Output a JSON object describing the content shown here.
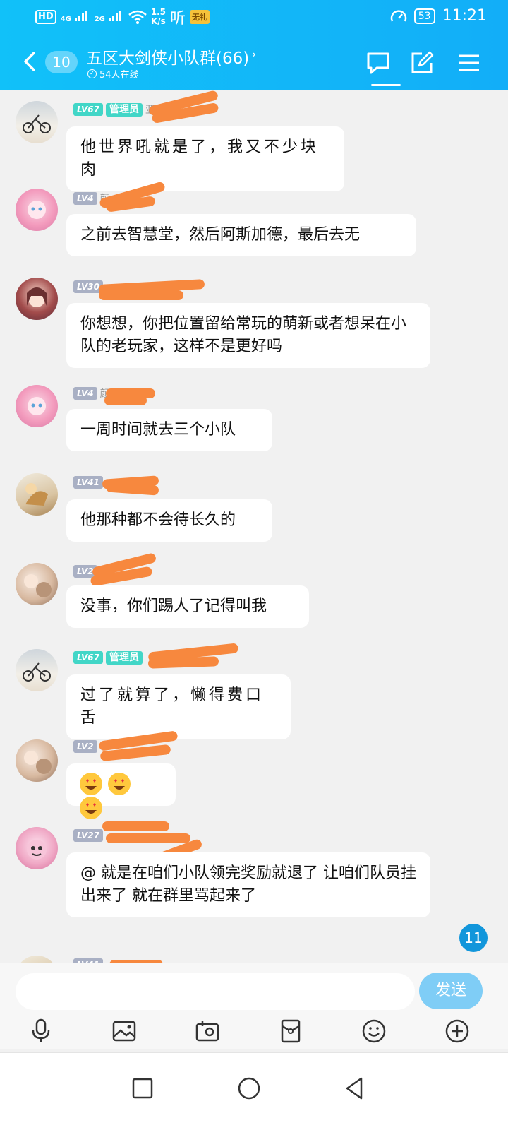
{
  "status_bar": {
    "hd_label": "HD",
    "net1": "4G",
    "net2": "2G",
    "speed_value": "1.5",
    "speed_unit": "K/s",
    "listen_label": "听",
    "badge_text": "无礼",
    "battery": "53",
    "time": "11:21"
  },
  "header": {
    "back_count": "10",
    "group_name": "五区大剑侠小队群(66)",
    "online_text": "54人在线"
  },
  "messages": [
    {
      "level": "LV67",
      "role": "管理员",
      "nick": "亚",
      "text": "他世界吼就是了，我又不少块肉",
      "hand": true
    },
    {
      "level": "LV4",
      "role": "",
      "nick": "颜",
      "text": "之前去智慧堂，然后阿斯加德，最后去无",
      "hand": false
    },
    {
      "level": "LV30",
      "role": "",
      "nick": "",
      "text": "你想想，你把位置留给常玩的萌新或者想呆在小队的老玩家，这样不是更好吗",
      "hand": false
    },
    {
      "level": "LV4",
      "role": "",
      "nick": "颜",
      "text": "一周时间就去三个小队",
      "hand": false
    },
    {
      "level": "LV41",
      "role": "",
      "nick": "",
      "text": "他那种都不会待长久的",
      "hand": false
    },
    {
      "level": "LV2",
      "role": "",
      "nick": "",
      "text": "没事，你们踢人了记得叫我",
      "hand": false
    },
    {
      "level": "LV67",
      "role": "管理员",
      "nick": "",
      "text": "过了就算了，懒得费口舌",
      "hand": true
    },
    {
      "level": "LV2",
      "role": "",
      "nick": "",
      "text": "",
      "hand": false
    },
    {
      "level": "LV27",
      "role": "",
      "nick": "",
      "text": "@                就是在咱们小队领完奖励就退了 让咱们队员挂出来了 就在群里骂起来了",
      "hand": false
    },
    {
      "level": "LV41",
      "role": "",
      "nick": "",
      "text": "",
      "hand": false
    }
  ],
  "unread_float": "11",
  "composer": {
    "placeholder": "",
    "send_label": "发送"
  },
  "icons": {
    "toolbar": [
      "mic-icon",
      "image-icon",
      "camera-icon",
      "red-packet-icon",
      "emoji-icon",
      "plus-icon"
    ],
    "sysnav": [
      "recents-icon",
      "home-icon",
      "back-icon"
    ]
  },
  "colors": {
    "header": "#12b6f8",
    "redaction": "#f7883e",
    "send": "#7fcdf6",
    "admin": "#42d6c7"
  }
}
